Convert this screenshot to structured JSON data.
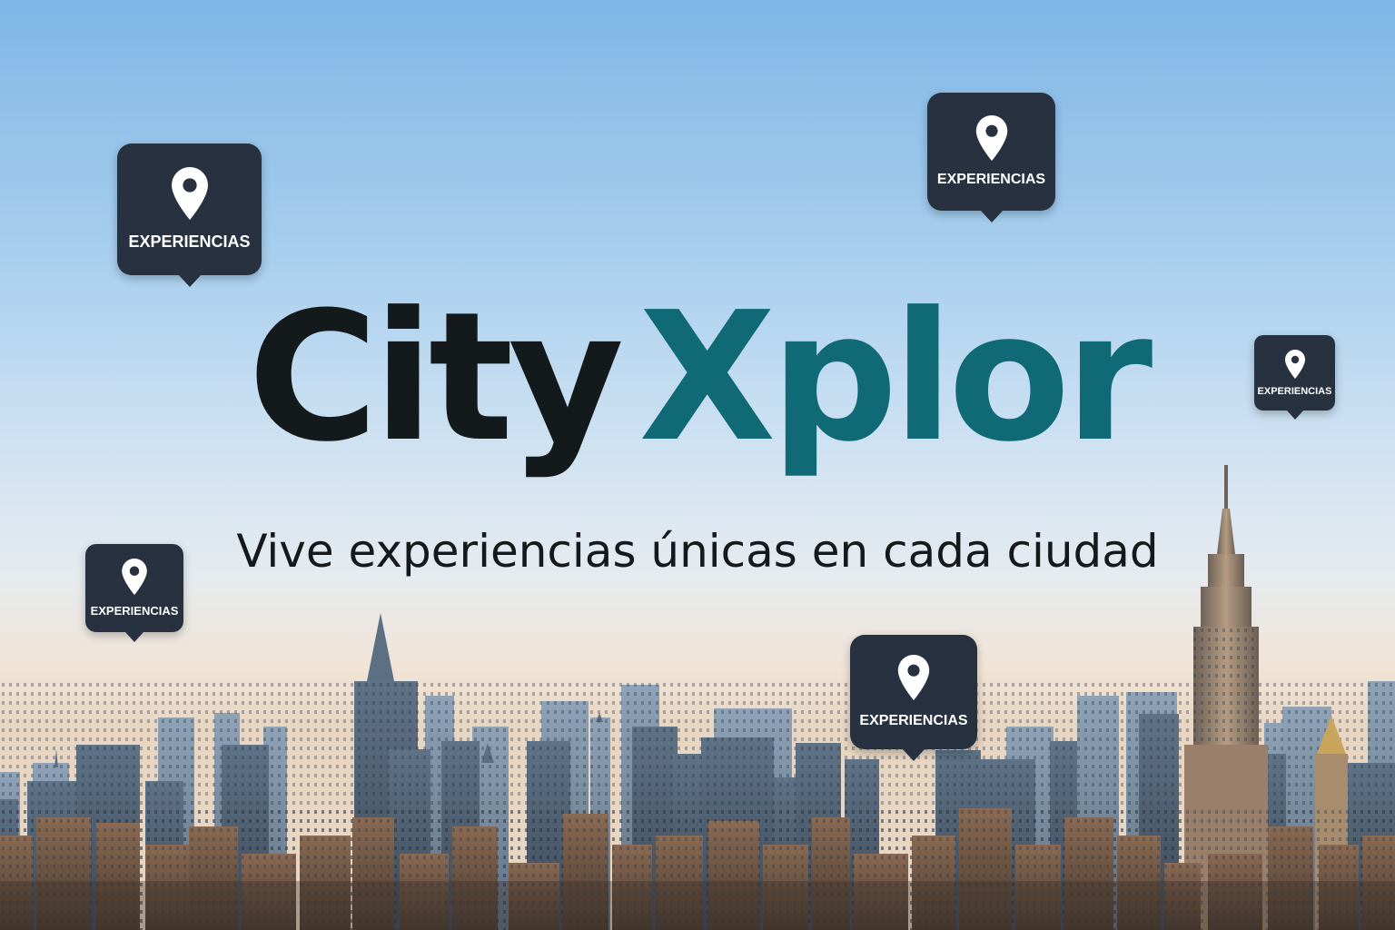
{
  "brand": {
    "word1": "City",
    "word2": "Xplor",
    "colors": {
      "primary": "#141a1c",
      "accent": "#0f6a76"
    }
  },
  "tagline": "Vive experiencias únicas en cada ciudad",
  "pins": [
    {
      "label": "EXPERIENCIAS",
      "icon": "map-pin-icon"
    },
    {
      "label": "EXPERIENCIAS",
      "icon": "map-pin-icon"
    },
    {
      "label": "EXPERIENCIAS",
      "icon": "map-pin-icon"
    },
    {
      "label": "EXPERIENCIAS",
      "icon": "map-pin-icon"
    },
    {
      "label": "EXPERIENCIAS",
      "icon": "map-pin-icon"
    }
  ],
  "background": {
    "sky_top": "#7fb6e6",
    "sky_horizon": "#f1e4d6",
    "marker_fill": "#27313f"
  }
}
